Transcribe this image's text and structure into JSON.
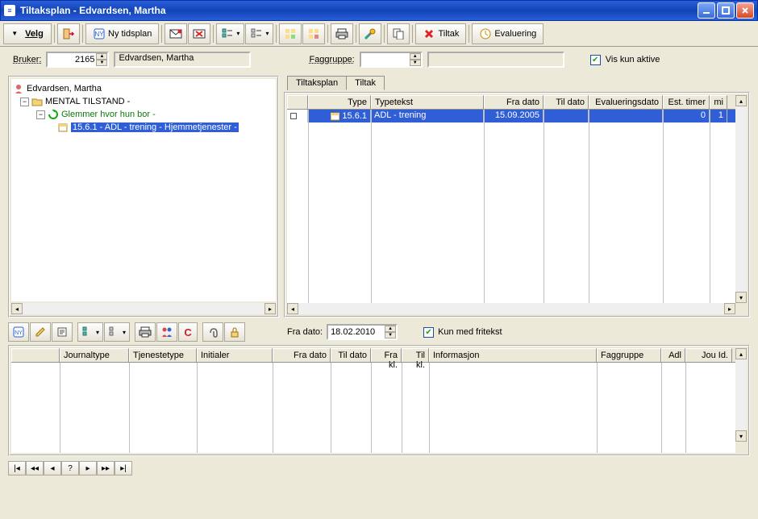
{
  "window": {
    "title": "Tiltaksplan - Edvardsen, Martha"
  },
  "menu": {
    "velg": "Velg"
  },
  "toolbar": {
    "ny_tidsplan": "Ny tidsplan",
    "tiltak": "Tiltak",
    "evaluering": "Evaluering"
  },
  "form": {
    "bruker_label": "Bruker:",
    "bruker_id": "2165",
    "bruker_navn": "Edvardsen, Martha",
    "faggruppe_label": "Faggruppe:",
    "faggruppe_value": "",
    "faggruppe_desc": "",
    "vis_kun_aktive": "Vis kun aktive"
  },
  "tabs": {
    "tiltaksplan": "Tiltaksplan",
    "tiltak": "Tiltak",
    "active": "tiltak"
  },
  "tree": {
    "root": "Edvardsen, Martha",
    "group": "MENTAL TILSTAND -",
    "item": "Glemmer hvor hun bor -",
    "leaf": "15.6.1 - ADL - trening - Hjemmetjenester -"
  },
  "grid": {
    "headers": {
      "type": "Type",
      "typetekst": "Typetekst",
      "fra_dato": "Fra dato",
      "til_dato": "Til dato",
      "eval_dato": "Evalueringsdato",
      "est_timer": "Est. timer",
      "mi": "mi"
    },
    "rows": [
      {
        "type": "15.6.1",
        "typetekst": "ADL - trening",
        "fra_dato": "15.09.2005",
        "til_dato": "",
        "eval_dato": "",
        "est_timer": "0",
        "mi": "1"
      }
    ]
  },
  "bottom": {
    "fra_dato_label": "Fra dato:",
    "fra_dato_value": "18.02.2010",
    "kun_fritekst": "Kun med fritekst",
    "headers": {
      "journaltype": "Journaltype",
      "tjenestetype": "Tjenestetype",
      "initialer": "Initialer",
      "fra_dato": "Fra dato",
      "til_dato": "Til dato",
      "fra_kl": "Fra kl.",
      "til_kl": "Til kl.",
      "informasjon": "Informasjon",
      "faggruppe": "Faggruppe",
      "adl": "Adl",
      "jou_id": "Jou Id."
    }
  },
  "nav": {
    "q": "?"
  }
}
